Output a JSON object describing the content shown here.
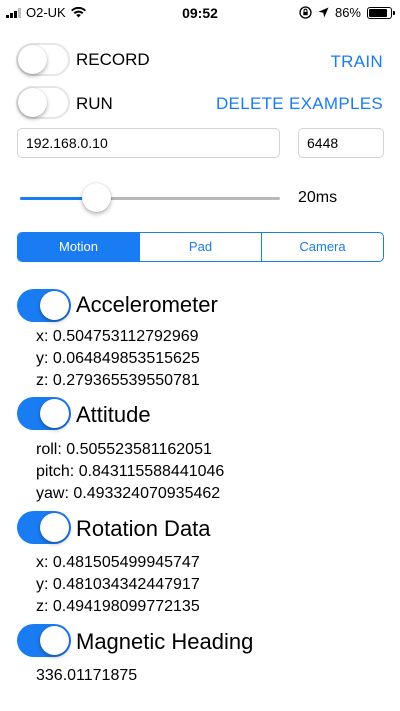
{
  "status_bar": {
    "carrier": "O2-UK",
    "time": "09:52",
    "battery": "86%",
    "battery_level": 0.86
  },
  "controls": {
    "record": {
      "label": "RECORD",
      "on": false
    },
    "run": {
      "label": "RUN",
      "on": false
    },
    "train_label": "TRAIN",
    "delete_label": "DELETE EXAMPLES",
    "ip_value": "192.168.0.10",
    "port_value": "6448",
    "slider_fraction": 0.27,
    "slider_value": "20ms"
  },
  "tabs": [
    {
      "label": "Motion",
      "active": true
    },
    {
      "label": "Pad",
      "active": false
    },
    {
      "label": "Camera",
      "active": false
    }
  ],
  "sections": {
    "accelerometer": {
      "title": "Accelerometer",
      "on": true,
      "lines": [
        "x: 0.504753112792969",
        "y: 0.064849853515625",
        "z: 0.279365539550781"
      ]
    },
    "attitude": {
      "title": "Attitude",
      "on": true,
      "lines": [
        "roll: 0.505523581162051",
        "pitch: 0.843115588441046",
        "yaw: 0.493324070935462"
      ]
    },
    "rotation": {
      "title": "Rotation Data",
      "on": true,
      "lines": [
        "x: 0.481505499945747",
        "y: 0.481034342447917",
        "z: 0.494198099772135"
      ]
    },
    "magnetic": {
      "title": "Magnetic Heading",
      "on": true,
      "lines": [
        "336.01171875"
      ]
    }
  },
  "colors": {
    "accent": "#1a7cf2"
  }
}
